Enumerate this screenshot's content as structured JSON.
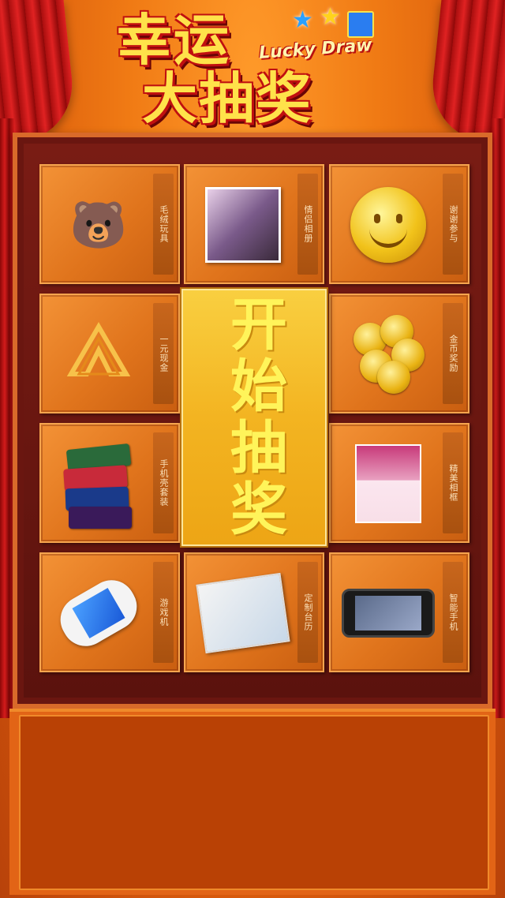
{
  "header": {
    "title_line1": "幸运",
    "title_line2": "大抽奖",
    "title_en": "Lucky Draw"
  },
  "start_button": {
    "label": "开始抽奖"
  },
  "prizes": [
    {
      "label": "毛绒玩具",
      "icon": "plush-toy-icon"
    },
    {
      "label": "情侣相册",
      "icon": "photo-album-icon"
    },
    {
      "label": "谢谢参与",
      "icon": "smiley-icon"
    },
    {
      "label": "一元现金",
      "icon": "logo-icon"
    },
    {
      "label": "金币奖励",
      "icon": "coins-icon"
    },
    {
      "label": "手机壳套装",
      "icon": "phone-case-icon"
    },
    {
      "label": "精美相框",
      "icon": "photo-frame-icon"
    },
    {
      "label": "游戏机",
      "icon": "game-console-icon"
    },
    {
      "label": "定制台历",
      "icon": "calendar-icon"
    },
    {
      "label": "智能手机",
      "icon": "smartphone-icon"
    }
  ],
  "colors": {
    "background": "#f07a14",
    "board": "#5a120d",
    "cell": "#e0741c",
    "start_button": "#f3b421",
    "start_text": "#fff45a",
    "panel": "#b94105"
  }
}
